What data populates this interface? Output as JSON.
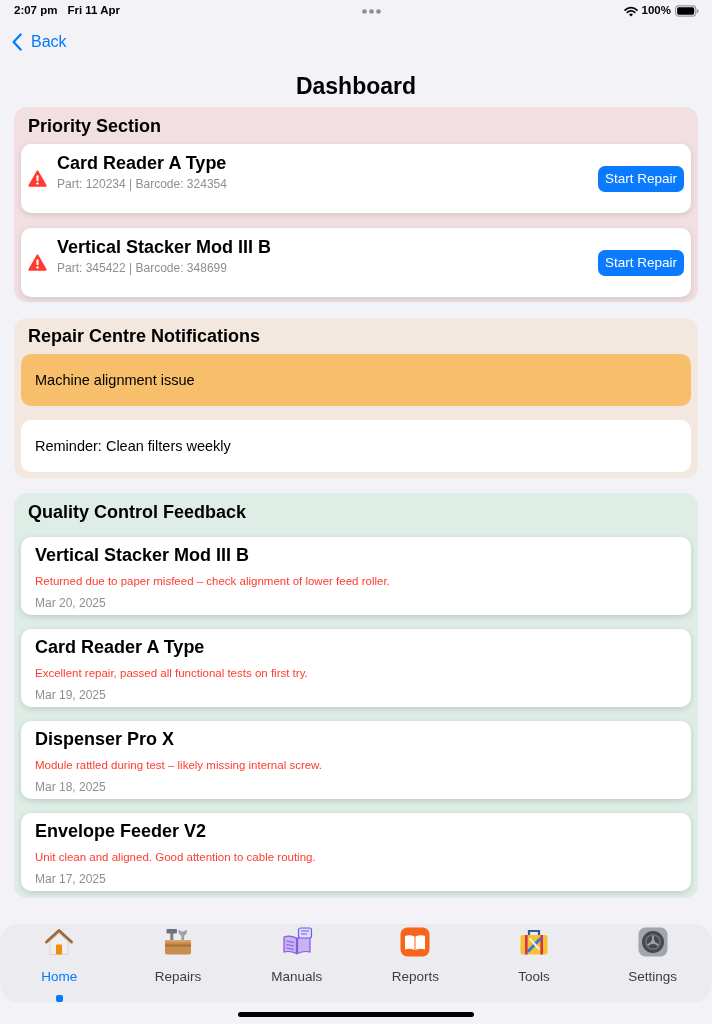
{
  "status_bar": {
    "time": "2:07 pm",
    "date": "Fri 11 Apr",
    "battery": "100%"
  },
  "navigation": {
    "back": "Back",
    "title": "Dashboard"
  },
  "priority_section": {
    "title": "Priority Section",
    "items": [
      {
        "name": "Card Reader A Type",
        "details": "Part: 120234 | Barcode: 324354",
        "action": "Start Repair"
      },
      {
        "name": "Vertical Stacker Mod III B",
        "details": "Part: 345422 | Barcode: 348699",
        "action": "Start Repair"
      }
    ]
  },
  "notifications": {
    "title": "Repair Centre Notifications",
    "items": [
      {
        "text": "Machine alignment issue",
        "highlighted": true
      },
      {
        "text": "Reminder: Clean filters weekly",
        "highlighted": false
      }
    ]
  },
  "quality_feedback": {
    "title": "Quality Control Feedback",
    "items": [
      {
        "name": "Vertical Stacker Mod III B",
        "comment": "Returned due to paper misfeed – check alignment of lower feed roller.",
        "date": "Mar 20, 2025"
      },
      {
        "name": "Card Reader A Type",
        "comment": "Excellent repair, passed all functional tests on first try.",
        "date": "Mar 19, 2025"
      },
      {
        "name": "Dispenser Pro X",
        "comment": "Module rattled during test – likely missing internal screw.",
        "date": "Mar 18, 2025"
      },
      {
        "name": "Envelope Feeder V2",
        "comment": "Unit clean and aligned. Good attention to cable routing.",
        "date": "Mar 17, 2025"
      }
    ]
  },
  "tab_bar": {
    "tabs": [
      {
        "label": "Home",
        "selected": true
      },
      {
        "label": "Repairs",
        "selected": false
      },
      {
        "label": "Manuals",
        "selected": false
      },
      {
        "label": "Reports",
        "selected": false
      },
      {
        "label": "Tools",
        "selected": false
      },
      {
        "label": "Settings",
        "selected": false
      }
    ]
  }
}
